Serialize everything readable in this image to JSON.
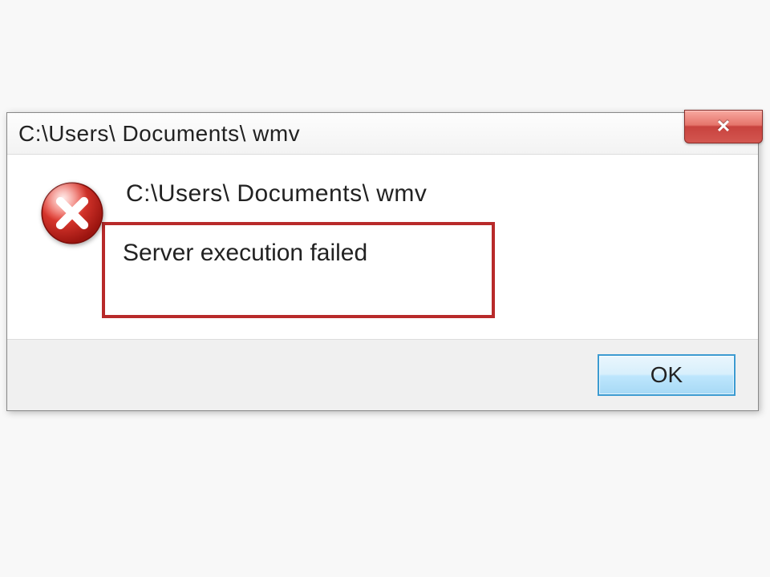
{
  "dialog": {
    "title": "C:\\Users\\ Documents\\  wmv",
    "content_path": "C:\\Users\\ Documents\\  wmv",
    "error_message": "Server execution failed",
    "ok_label": "OK"
  }
}
